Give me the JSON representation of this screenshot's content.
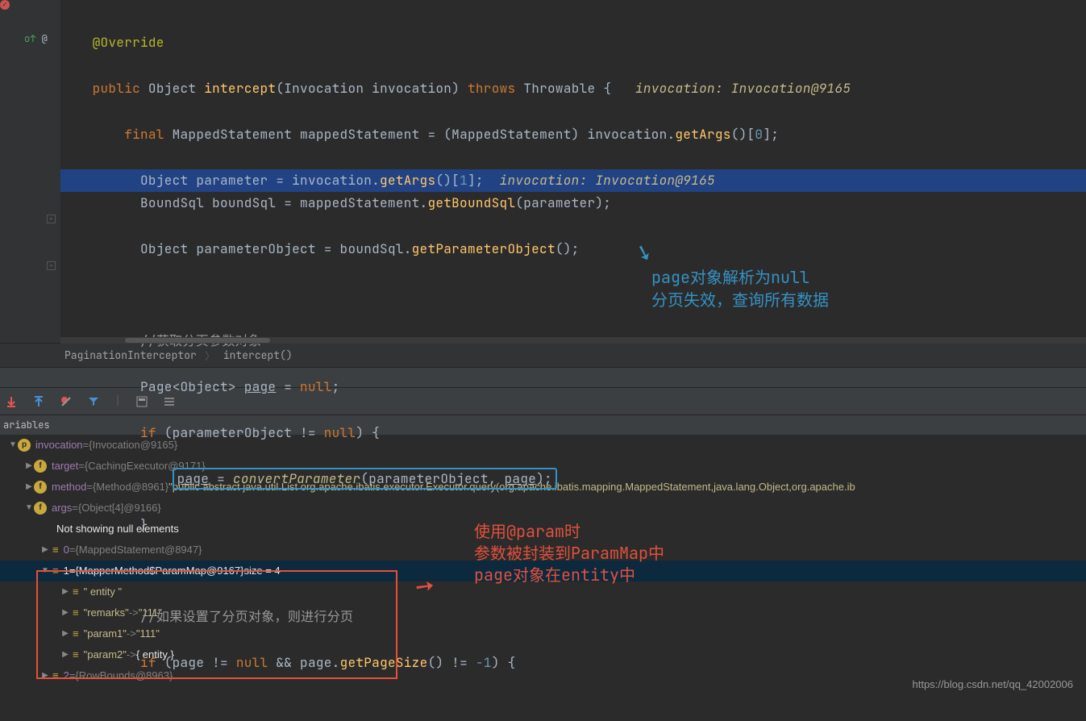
{
  "breadcrumb": {
    "class": "PaginationInterceptor",
    "method": "intercept()"
  },
  "code": {
    "ann_override": "@Override",
    "kw_public": "public",
    "type_object": "Object",
    "m_intercept": "intercept",
    "type_invocation": "Invocation",
    "p_invocation": "invocation",
    "kw_throws": "throws",
    "type_throwable": "Throwable",
    "hint_inv1": "invocation: Invocation@9165",
    "kw_final": "final",
    "type_mapped": "MappedStatement",
    "v_mapped": "mappedStatement",
    "cast_mapped": "(MappedStatement)",
    "call_getargs": "getArgs",
    "idx0": "0",
    "idx1": "1",
    "v_parameter": "parameter",
    "hint_inv2": "invocation: Invocation@9165",
    "type_boundsql": "BoundSql",
    "v_boundsql": "boundSql",
    "call_getbs": "getBoundSql",
    "v_paramobj": "parameterObject",
    "call_getpo": "getParameterObject",
    "comm1": "//获取分页参数对象",
    "type_page": "Page<Object>",
    "v_page": "page",
    "kw_null": "null",
    "kw_if": "if",
    "m_convert": "convertParameter",
    "comm2": "//如果设置了分页对象，则进行分页",
    "call_gps": "getPageSize",
    "neg1": "-1"
  },
  "note_blue": {
    "l1": "page对象解析为null",
    "l2": "分页失效，查询所有数据"
  },
  "note_red": {
    "l1": "使用@param时",
    "l2": "参数被封装到ParamMap中",
    "l3": "page对象在entity中"
  },
  "panel": {
    "vars_label": "ariables"
  },
  "vars": {
    "r1": {
      "name": "invocation",
      "val": "{Invocation@9165}"
    },
    "r2": {
      "name": "target",
      "val": "{CachingExecutor@9171}"
    },
    "r3": {
      "name": "method",
      "val": "{Method@8961}",
      "str": "\"public abstract java.util.List org.apache.ibatis.executor.Executor.query(org.apache.ibatis.mapping.MappedStatement,java.lang.Object,org.apache.ib"
    },
    "r4": {
      "name": "args",
      "val": "{Object[4]@9166}"
    },
    "r5": {
      "text": "Not showing null elements"
    },
    "r6": {
      "name": "0",
      "val": "{MappedStatement@8947}"
    },
    "r7": {
      "name": "1",
      "val": "{MapperMethod$ParamMap@9167}",
      "extra": " size = 4"
    },
    "r8": {
      "key": "\" entity \""
    },
    "r9": {
      "key": "\"remarks\"",
      "arrow": "->",
      "v": "\"111\""
    },
    "r10": {
      "key": "\"param1\"",
      "arrow": "->",
      "v": "\"111\""
    },
    "r11": {
      "key": "\"param2\"",
      "arrow": "->",
      "v2": "{ entity }"
    },
    "r12": {
      "name": "2",
      "val": "{RowBounds@8963}"
    }
  },
  "watermark": "https://blog.csdn.net/qq_42002006"
}
